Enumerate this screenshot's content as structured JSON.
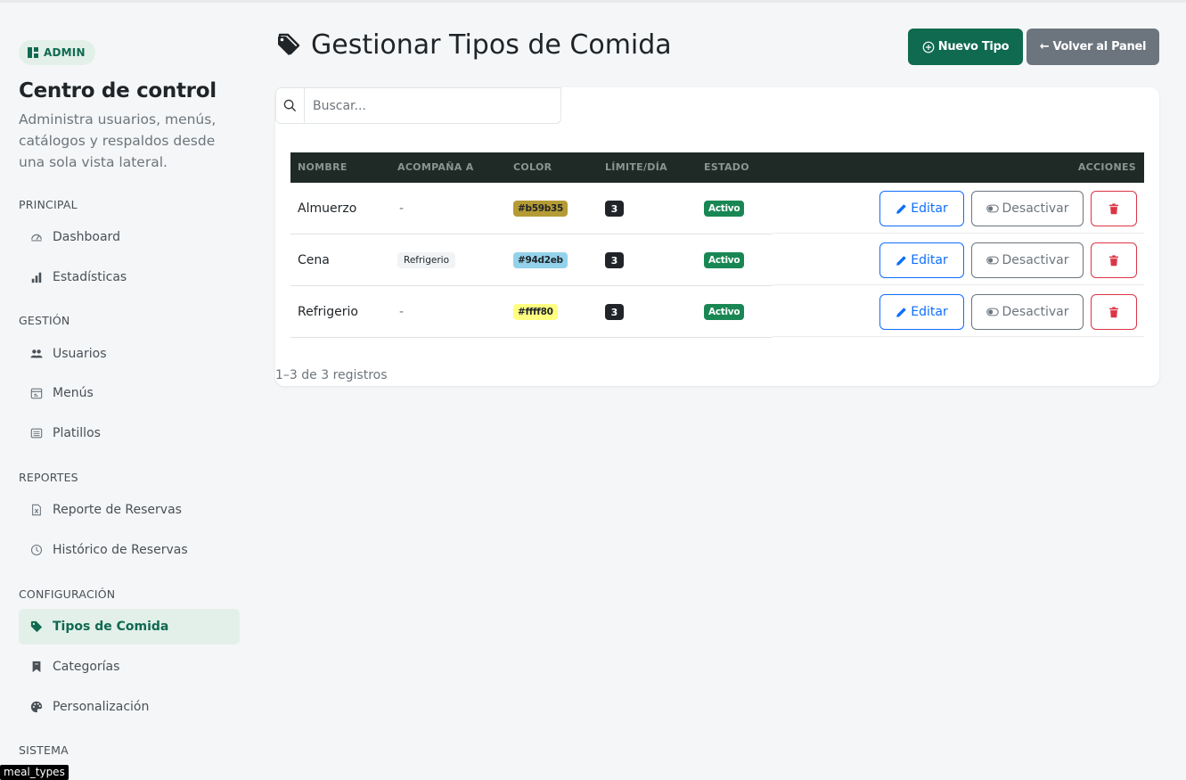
{
  "sidebar": {
    "badge": "ADMIN",
    "title": "Centro de control",
    "description": "Administra usuarios, menús, catálogos y respaldos desde una sola vista lateral.",
    "sections": {
      "principal": "PRINCIPAL",
      "gestion": "GESTIÓN",
      "reportes": "REPORTES",
      "configuracion": "CONFIGURACIÓN",
      "sistema": "SISTEMA"
    },
    "items": {
      "dashboard": "Dashboard",
      "estadisticas": "Estadísticas",
      "usuarios": "Usuarios",
      "menus": "Menús",
      "platillos": "Platillos",
      "reporte_reservas": "Reporte de Reservas",
      "historico_reservas": "Histórico de Reservas",
      "tipos_comida": "Tipos de Comida",
      "categorias": "Categorías",
      "personalizacion": "Personalización"
    },
    "tooltip": "meal_types"
  },
  "header": {
    "title": "Gestionar Tipos de Comida",
    "new_button": "Nuevo Tipo",
    "back_button": "Volver al Panel"
  },
  "search": {
    "placeholder": "Buscar..."
  },
  "table": {
    "columns": [
      "NOMBRE",
      "ACOMPAÑA A",
      "COLOR",
      "LÍMITE/DÍA",
      "ESTADO",
      "ACCIONES"
    ],
    "rows": [
      {
        "nombre": "Almuerzo",
        "acompana": "-",
        "color": "#b59b35",
        "limite": "3",
        "estado": "Activo"
      },
      {
        "nombre": "Cena",
        "acompana": "Refrigerio",
        "color": "#94d2eb",
        "limite": "3",
        "estado": "Activo"
      },
      {
        "nombre": "Refrigerio",
        "acompana": "-",
        "color": "#ffff80",
        "limite": "3",
        "estado": "Activo"
      }
    ],
    "actions": {
      "edit": "Editar",
      "deactivate": "Desactivar"
    },
    "footer": "1–3 de 3 registros"
  },
  "colors": {
    "primary": "#0f6a4f",
    "secondary": "#6c757d",
    "active_bg": "#e2f0e9",
    "table_header": "#1f2a26",
    "success": "#198754",
    "edit": "#0d6efd",
    "danger": "#dc3545"
  },
  "icons": {
    "nav": [
      "speedometer-icon",
      "bar-chart-icon",
      "people-icon",
      "calendar-icon",
      "list-icon",
      "file-excel-icon",
      "clock-history-icon",
      "tag-icon",
      "bookmark-icon",
      "palette-icon"
    ]
  }
}
